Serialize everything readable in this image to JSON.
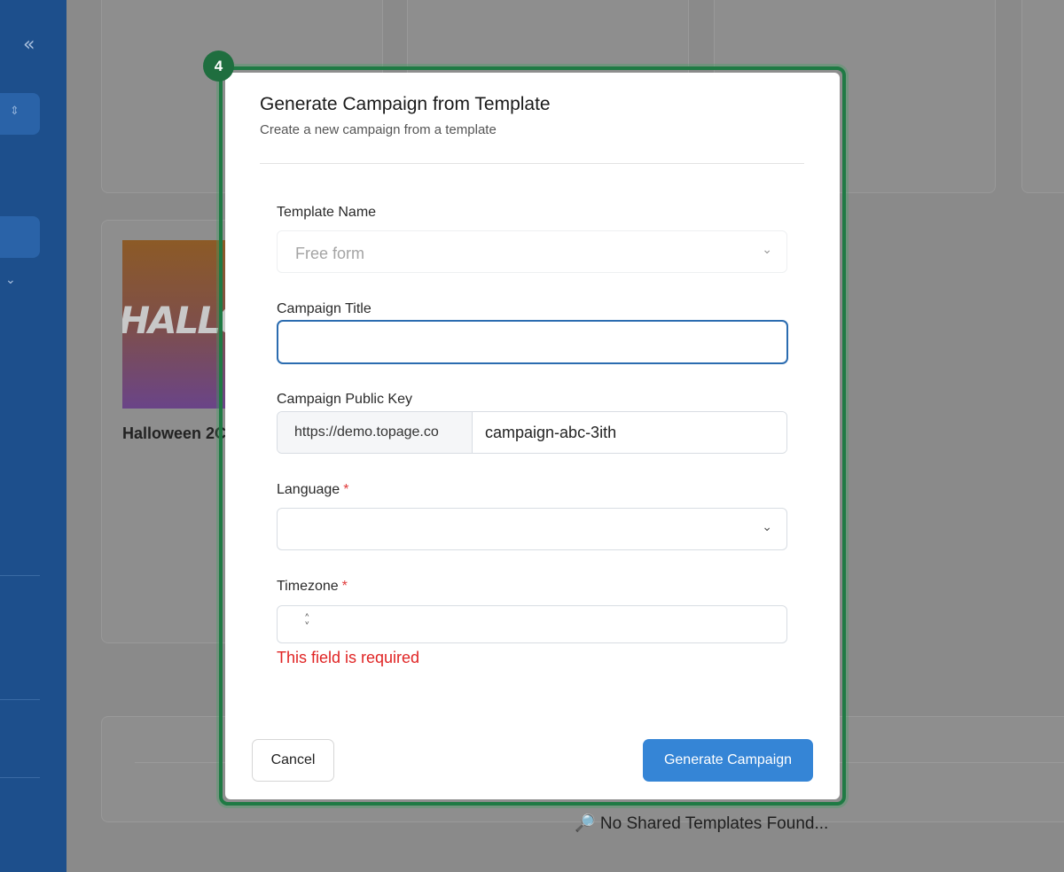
{
  "sidebar": {
    "collapse_icon": "«",
    "select_icon": "⇕",
    "chevron_icon": "⌄"
  },
  "background": {
    "card_thumbnail_text": "HALLOWEEN",
    "card_title": "Halloween 2C",
    "empty_state": "🔎 No Shared Templates Found..."
  },
  "step_badge": "4",
  "modal": {
    "title": "Generate Campaign from Template",
    "subtitle": "Create a new campaign from a template",
    "template_name": {
      "label": "Template Name",
      "value": "Free form"
    },
    "campaign_title": {
      "label": "Campaign Title",
      "value": ""
    },
    "public_key": {
      "label": "Campaign Public Key",
      "prefix": "https://demo.topage.co",
      "value": "campaign-abc-3ith"
    },
    "language": {
      "label": "Language",
      "required_mark": "*",
      "value": ""
    },
    "timezone": {
      "label": "Timezone",
      "required_mark": "*",
      "value": "",
      "error": "This field is required"
    },
    "cancel_label": "Cancel",
    "submit_label": "Generate Campaign"
  },
  "colors": {
    "primary": "#3585d6",
    "sidebar": "#1d4f8c",
    "highlight": "#1f7a44",
    "error": "#e02424"
  }
}
